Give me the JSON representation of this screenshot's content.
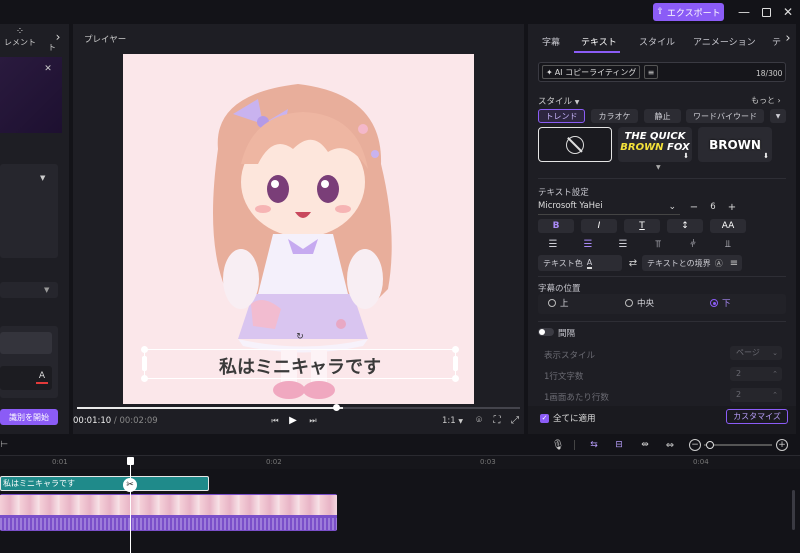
{
  "titlebar": {
    "export_label": "エクスポート"
  },
  "left": {
    "element_label": "レメント",
    "tab_partial": "ト",
    "start_button": "識別を開始"
  },
  "player": {
    "title": "プレイヤー",
    "subtitle": "私はミニキャラです",
    "time_current": "00:01:10",
    "time_sep": "/",
    "time_total": "00:02:09",
    "progress": 0.6,
    "ratio": "1:1"
  },
  "right": {
    "tabs": [
      "字幕",
      "テキスト",
      "スタイル",
      "アニメーション",
      "テ"
    ],
    "active_tab": "テキスト",
    "ai_label": "AI コピーライティング",
    "char_count": "18/300",
    "style_label": "スタイル",
    "more_label": "もっと",
    "style_filters": [
      "トレンド",
      "カラオケ",
      "静止",
      "ワードバイウード"
    ],
    "preset_quick_1": "THE QUICK",
    "preset_quick_2": "BROWN",
    "preset_quick_3": "FOX",
    "preset_brown": "BROWN",
    "text_settings_label": "テキスト設定",
    "font_name": "Microsoft YaHei",
    "font_size": "6",
    "minus": "−",
    "plus": "+",
    "aa_label": "AA",
    "text_color_label": "テキスト色",
    "text_border_label": "テキストとの境界",
    "position_label": "字幕の位置",
    "positions": [
      "上",
      "中央",
      "下"
    ],
    "selected_position": "下",
    "spacing_label": "間隔",
    "display_style_label": "表示スタイル",
    "display_style_value": "ページ",
    "chars_per_line_label": "1行文字数",
    "chars_per_line_value": "2",
    "lines_per_screen_label": "1画面あたり行数",
    "lines_per_screen_value": "2",
    "apply_all_label": "全てに適用",
    "customize_label": "カスタマイズ"
  },
  "timeline": {
    "ticks": [
      "0:01",
      "0:02",
      "0:03",
      "0:04"
    ],
    "caption_clip": "私はミニキャラです"
  },
  "colors": {
    "accent": "#8b5cf6",
    "caption_clip": "#1f8a8a",
    "video_clip": "#7a4fc9"
  }
}
